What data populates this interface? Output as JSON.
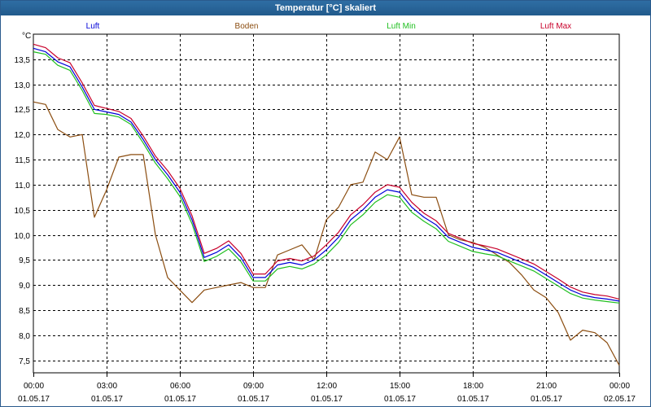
{
  "window": {
    "title": "Temperatur [°C] skaliert"
  },
  "colors": {
    "luft": "#0000d8",
    "boden": "#8b4d10",
    "luft_min": "#1fbf1f",
    "luft_max": "#c8002a",
    "grid": "#000000",
    "background": "#ffffff",
    "titlebar": "#265f94"
  },
  "chart_data": {
    "type": "line",
    "title": "Temperatur [°C] skaliert",
    "ylabel": "°C",
    "xlabel": "",
    "ylim": [
      7.25,
      14.0
    ],
    "xlim": [
      "01.05.17 00:00",
      "02.05.17 00:00"
    ],
    "y_ticks": [
      "13,5",
      "13,0",
      "12,5",
      "12,0",
      "11,5",
      "11,0",
      "10,5",
      "10,0",
      "9,5",
      "9,0",
      "8,5",
      "8,0",
      "7,5"
    ],
    "x_ticks": [
      {
        "time": "00:00",
        "date": "01.05.17"
      },
      {
        "time": "03:00",
        "date": "01.05.17"
      },
      {
        "time": "06:00",
        "date": "01.05.17"
      },
      {
        "time": "09:00",
        "date": "01.05.17"
      },
      {
        "time": "12:00",
        "date": "01.05.17"
      },
      {
        "time": "15:00",
        "date": "01.05.17"
      },
      {
        "time": "18:00",
        "date": "01.05.17"
      },
      {
        "time": "21:00",
        "date": "01.05.17"
      },
      {
        "time": "00:00",
        "date": "02.05.17"
      }
    ],
    "grid": true,
    "legend_position": "top",
    "x_hours": [
      0,
      0.5,
      1,
      1.5,
      2,
      2.5,
      3,
      3.5,
      4,
      4.5,
      5,
      5.5,
      6,
      6.5,
      7,
      7.5,
      8,
      8.5,
      9,
      9.5,
      10,
      10.5,
      11,
      11.5,
      12,
      12.5,
      13,
      13.5,
      14,
      14.5,
      15,
      15.5,
      16,
      16.5,
      17,
      17.5,
      18,
      18.5,
      19,
      19.5,
      20,
      20.5,
      21,
      21.5,
      22,
      22.5,
      23,
      23.5,
      24
    ],
    "series": [
      {
        "name": "Luft",
        "values": [
          13.72,
          13.65,
          13.45,
          13.35,
          12.95,
          12.5,
          12.45,
          12.4,
          12.25,
          11.9,
          11.5,
          11.2,
          10.85,
          10.3,
          9.55,
          9.65,
          9.8,
          9.55,
          9.15,
          9.15,
          9.4,
          9.45,
          9.4,
          9.5,
          9.7,
          9.95,
          10.3,
          10.5,
          10.75,
          10.9,
          10.85,
          10.55,
          10.35,
          10.2,
          9.95,
          9.85,
          9.75,
          9.7,
          9.65,
          9.55,
          9.45,
          9.35,
          9.2,
          9.05,
          8.9,
          8.8,
          8.75,
          8.72,
          8.68
        ]
      },
      {
        "name": "Boden",
        "values": [
          12.65,
          12.6,
          12.1,
          11.95,
          12.0,
          10.35,
          10.9,
          11.55,
          11.6,
          11.6,
          10.0,
          9.15,
          8.9,
          8.65,
          8.9,
          8.95,
          9.0,
          9.05,
          8.95,
          8.95,
          9.6,
          9.7,
          9.8,
          9.5,
          10.3,
          10.55,
          11.0,
          11.05,
          11.65,
          11.5,
          11.95,
          10.8,
          10.75,
          10.75,
          10.0,
          9.9,
          9.85,
          9.75,
          9.6,
          9.45,
          9.2,
          8.9,
          8.75,
          8.45,
          7.9,
          8.1,
          8.05,
          7.85,
          7.4
        ]
      },
      {
        "name": "Luft Min",
        "values": [
          13.65,
          13.6,
          13.38,
          13.28,
          12.88,
          12.42,
          12.4,
          12.35,
          12.2,
          11.83,
          11.43,
          11.12,
          10.77,
          10.22,
          9.47,
          9.57,
          9.72,
          9.47,
          9.08,
          9.08,
          9.32,
          9.37,
          9.32,
          9.42,
          9.6,
          9.85,
          10.2,
          10.4,
          10.65,
          10.8,
          10.75,
          10.45,
          10.27,
          10.12,
          9.87,
          9.77,
          9.67,
          9.62,
          9.58,
          9.48,
          9.38,
          9.28,
          9.13,
          8.98,
          8.83,
          8.74,
          8.7,
          8.67,
          8.64
        ]
      },
      {
        "name": "Luft Max",
        "values": [
          13.8,
          13.73,
          13.53,
          13.43,
          13.03,
          12.58,
          12.52,
          12.46,
          12.32,
          11.97,
          11.57,
          11.28,
          10.93,
          10.38,
          9.63,
          9.73,
          9.88,
          9.63,
          9.22,
          9.22,
          9.48,
          9.53,
          9.48,
          9.58,
          9.8,
          10.05,
          10.4,
          10.6,
          10.85,
          11.0,
          10.95,
          10.65,
          10.43,
          10.28,
          10.03,
          9.93,
          9.83,
          9.78,
          9.72,
          9.62,
          9.52,
          9.42,
          9.27,
          9.12,
          8.96,
          8.86,
          8.81,
          8.78,
          8.72
        ]
      }
    ]
  }
}
